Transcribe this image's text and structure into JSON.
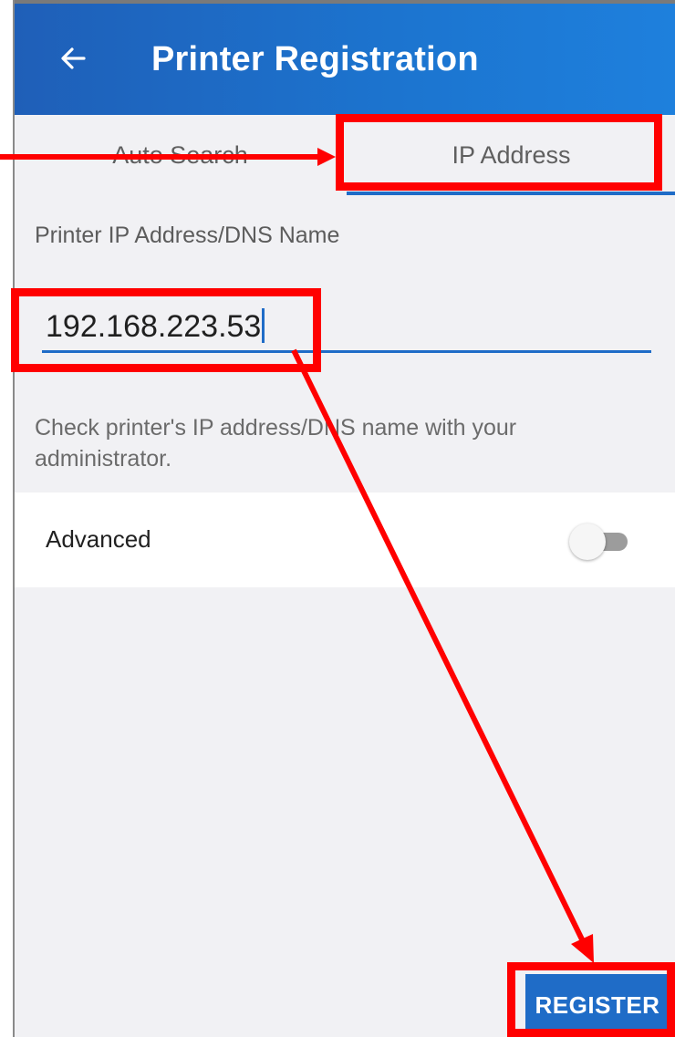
{
  "appbar": {
    "title": "Printer Registration",
    "back_icon": "arrow-left-icon"
  },
  "tabs": [
    {
      "label": "Auto Search",
      "selected": false
    },
    {
      "label": "IP Address",
      "selected": true
    }
  ],
  "form": {
    "field_label": "Printer IP Address/DNS Name",
    "ip_value": "192.168.223.53",
    "hint": "Check printer's IP address/DNS name with your administrator."
  },
  "advanced": {
    "label": "Advanced",
    "enabled": false
  },
  "actions": {
    "register_label": "REGISTER"
  },
  "colors": {
    "primary": "#1f6cc7",
    "annotation": "#ff0000"
  }
}
